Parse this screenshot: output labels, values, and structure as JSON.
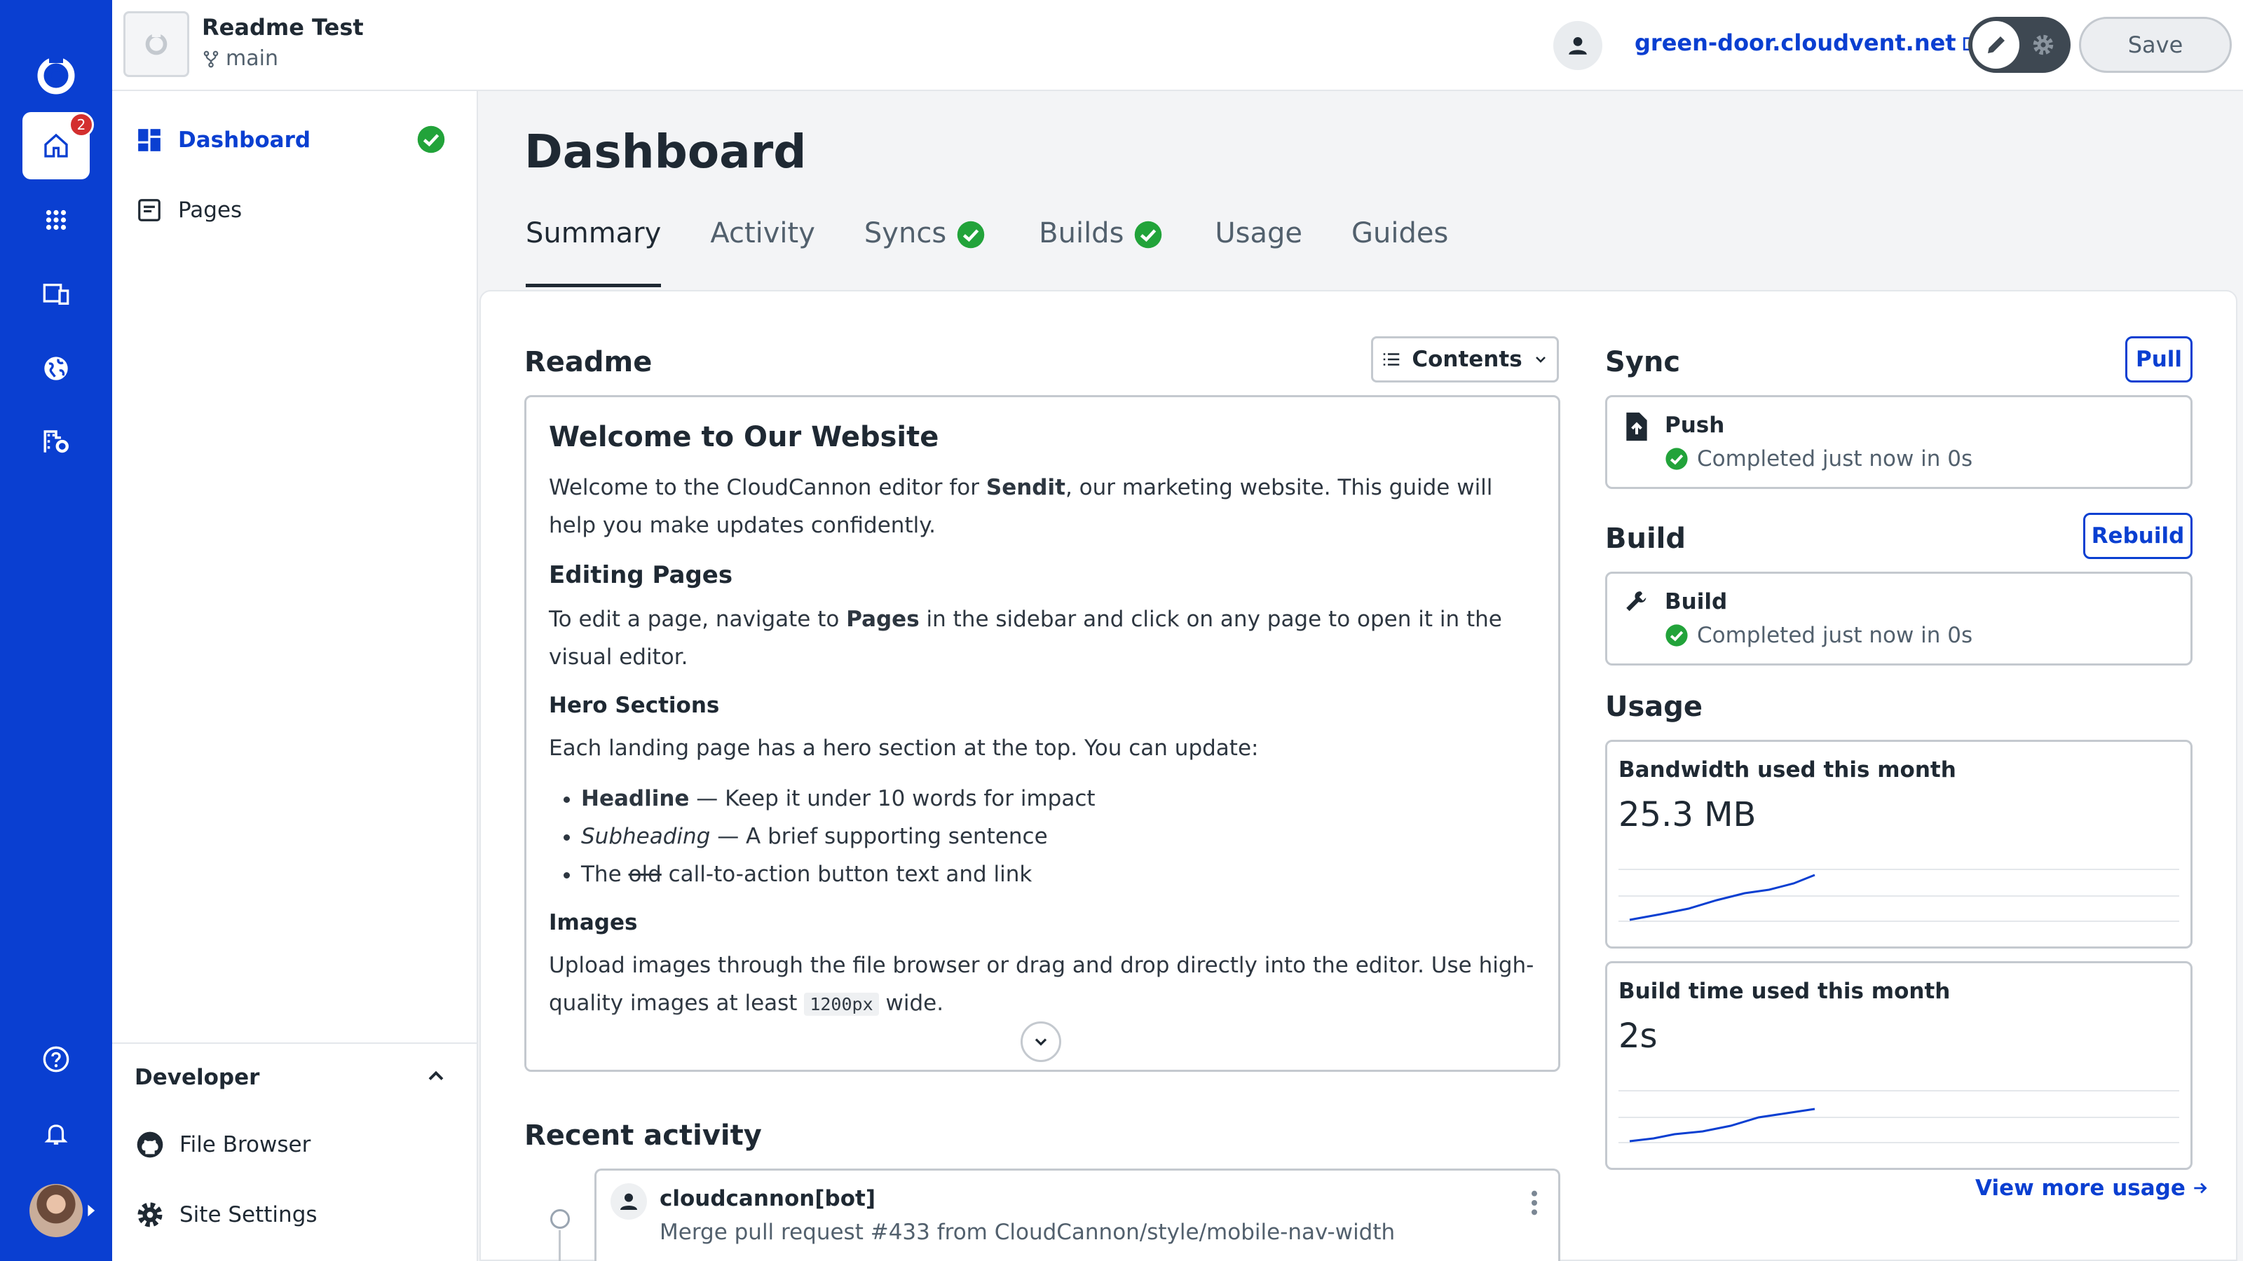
{
  "app": {
    "site_name": "Readme Test",
    "branch": "main",
    "site_url": "green-door.cloudvent.net",
    "save_label": "Save",
    "notifications_badge": "2"
  },
  "rail": {
    "items": [
      "home-icon",
      "apps-grid-icon",
      "devices-icon",
      "globe-icon",
      "organization-settings-icon",
      "help-icon",
      "bell-icon",
      "avatar"
    ]
  },
  "sidebar": {
    "items": [
      {
        "label": "Dashboard",
        "icon": "dashboard-icon",
        "active": true,
        "status": "check-icon"
      },
      {
        "label": "Pages",
        "icon": "pages-icon",
        "active": false
      }
    ],
    "developer": {
      "title": "Developer",
      "items": [
        {
          "label": "File Browser",
          "icon": "github-icon"
        },
        {
          "label": "Site Settings",
          "icon": "gear-icon"
        }
      ]
    }
  },
  "main": {
    "title": "Dashboard",
    "tabs": [
      {
        "label": "Summary",
        "active": true
      },
      {
        "label": "Activity"
      },
      {
        "label": "Syncs",
        "status": "check-icon"
      },
      {
        "label": "Builds",
        "status": "check-icon"
      },
      {
        "label": "Usage"
      },
      {
        "label": "Guides"
      }
    ]
  },
  "readme": {
    "title": "Readme",
    "contents_label": "Contents",
    "h1": "Welcome to Our Website",
    "intro_pre": "Welcome to the CloudCannon editor for ",
    "intro_bold": "Sendit",
    "intro_post": ", our marketing website. This guide will help you make updates confidently.",
    "h2_editing": "Editing Pages",
    "edit_pre": "To edit a page, navigate to ",
    "edit_bold": "Pages",
    "edit_post": " in the sidebar and click on any page to open it in the visual editor.",
    "h3_hero": "Hero Sections",
    "hero_text": "Each landing page has a hero section at the top. You can update:",
    "li1_bold": "Headline",
    "li1_rest": " — Keep it under 10 words for impact",
    "li2_italic": "Subheading",
    "li2_rest": " — A brief supporting sentence",
    "li3_pre": "The ",
    "li3_strike": "old",
    "li3_rest": " call-to-action button text and link",
    "h3_images": "Images",
    "images_text": "Upload images through the file browser or drag and drop directly into the editor. Use high-quality images at least ",
    "images_code": "1200px",
    "images_post": " wide."
  },
  "recent_activity": {
    "title": "Recent activity",
    "items": [
      {
        "user": "cloudcannon[bot]",
        "message": "Merge pull request #433 from CloudCannon/style/mobile-nav-width"
      }
    ]
  },
  "sync": {
    "title": "Sync",
    "button": "Pull",
    "item_label": "Push",
    "status": "Completed just now in 0s"
  },
  "build": {
    "title": "Build",
    "button": "Rebuild",
    "item_label": "Build",
    "status": "Completed just now in 0s"
  },
  "usage": {
    "title": "Usage",
    "bandwidth_label": "Bandwidth used this month",
    "bandwidth_value": "25.3 MB",
    "buildtime_label": "Build time used this month",
    "buildtime_value": "2s",
    "view_more": "View more usage",
    "accent": "#0a3fd1"
  },
  "colors": {
    "brand": "#0a3fd1",
    "success": "#22a33a",
    "badge": "#d32f2f"
  }
}
